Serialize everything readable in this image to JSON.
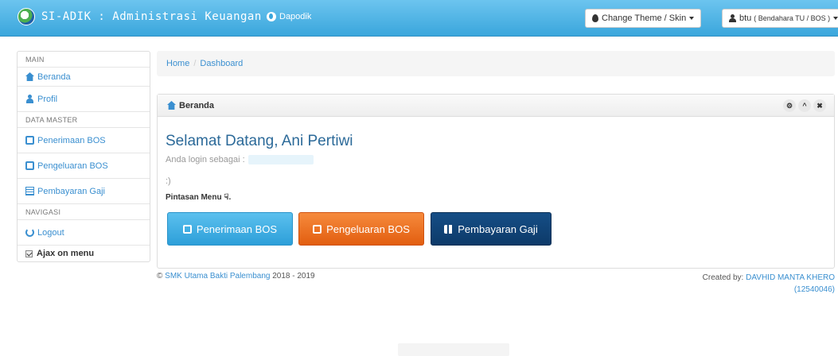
{
  "navbar": {
    "brand": "SI-ADIK : Administrasi Keuangan",
    "dapodik": "Dapodik",
    "theme_button": "Change Theme / Skin",
    "user_name": "btu",
    "user_role": "( Bendahara TU / BOS )"
  },
  "sidebar": {
    "main_header": "MAIN",
    "beranda": "Beranda",
    "profil": "Profil",
    "master_header": "DATA MASTER",
    "penerimaan": "Penerimaan BOS",
    "pengeluaran": "Pengeluaran BOS",
    "pembayaran": "Pembayaran Gaji",
    "nav_header": "NAVIGASI",
    "logout": "Logout",
    "ajax": "Ajax on menu"
  },
  "breadcrumb": {
    "home": "Home",
    "sep": "/",
    "current": "Dashboard"
  },
  "panel": {
    "title": "Beranda",
    "welcome": "Selamat Datang, Ani Pertiwi",
    "login_as": "Anda login sebagai :",
    "smile": ":)",
    "pintasan": "Pintasan Menu",
    "pintasan_suffix": ".",
    "btn_penerimaan": "Penerimaan BOS",
    "btn_pengeluaran": "Pengeluaran BOS",
    "btn_pembayaran": "Pembayaran Gaji",
    "tool_settings": "⚙",
    "tool_collapse": "^",
    "tool_close": "✖"
  },
  "footer": {
    "copyright": "©",
    "school": "SMK Utama Bakti Palembang",
    "years": "2018 - 2019",
    "created_by": "Created by:",
    "author": "DAVHID MANTA KHERO",
    "author_id": "(12540046)"
  }
}
